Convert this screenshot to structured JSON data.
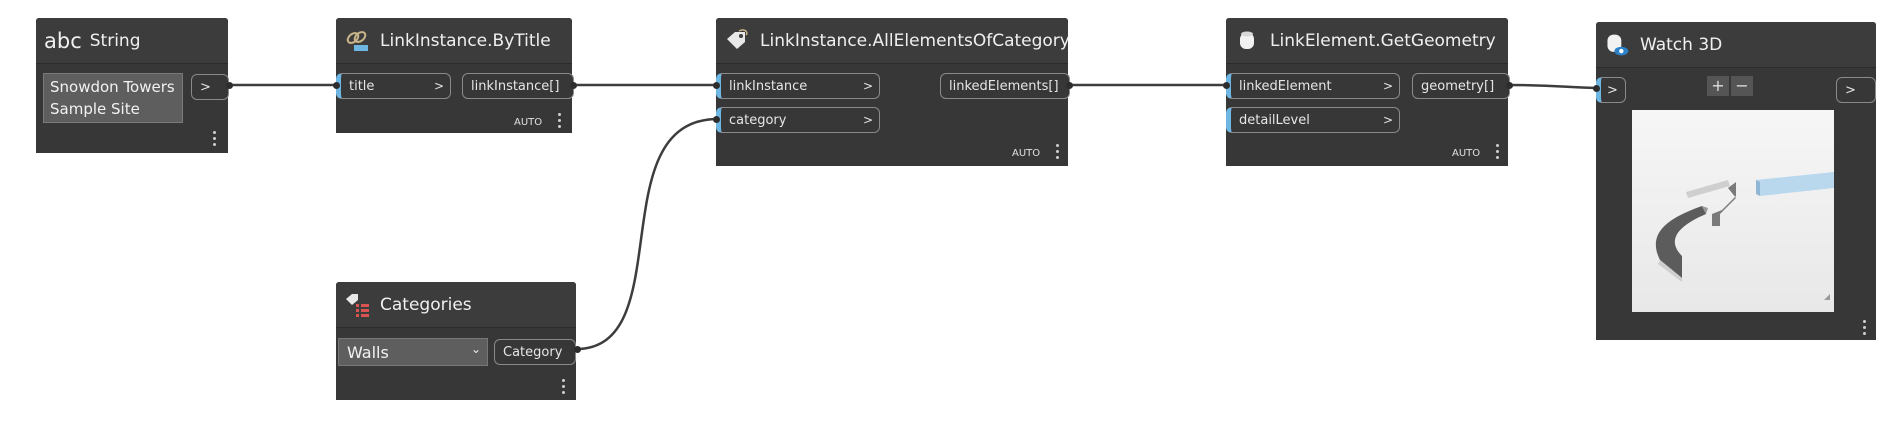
{
  "nodes": {
    "string": {
      "title": "String",
      "icon": "abc",
      "value": "Snowdon Towers Sample Site",
      "output_label": ">"
    },
    "by_title": {
      "title": "LinkInstance.ByTitle",
      "input": "title",
      "input_chevron": ">",
      "output": "linkInstance[]",
      "lacing": "AUTO"
    },
    "all_elements": {
      "title": "LinkInstance.AllElementsOfCategory",
      "inputs": [
        "linkInstance",
        "category"
      ],
      "input_chevron": ">",
      "output": "linkedElements[]",
      "lacing": "AUTO"
    },
    "get_geometry": {
      "title": "LinkElement.GetGeometry",
      "inputs": [
        "linkedElement",
        "detailLevel"
      ],
      "input_chevron": ">",
      "output": "geometry[]",
      "lacing": "AUTO"
    },
    "watch3d": {
      "title": "Watch 3D",
      "input_label": ">",
      "output_label": ">",
      "zoom_in": "+",
      "zoom_out": "−"
    },
    "categories": {
      "title": "Categories",
      "selected": "Walls",
      "output": "Category"
    }
  },
  "colors": {
    "node_body": "#373737",
    "port_accent": "#6eb7e3",
    "wire": "#3a3a3a",
    "canvas": "#ffffff"
  }
}
